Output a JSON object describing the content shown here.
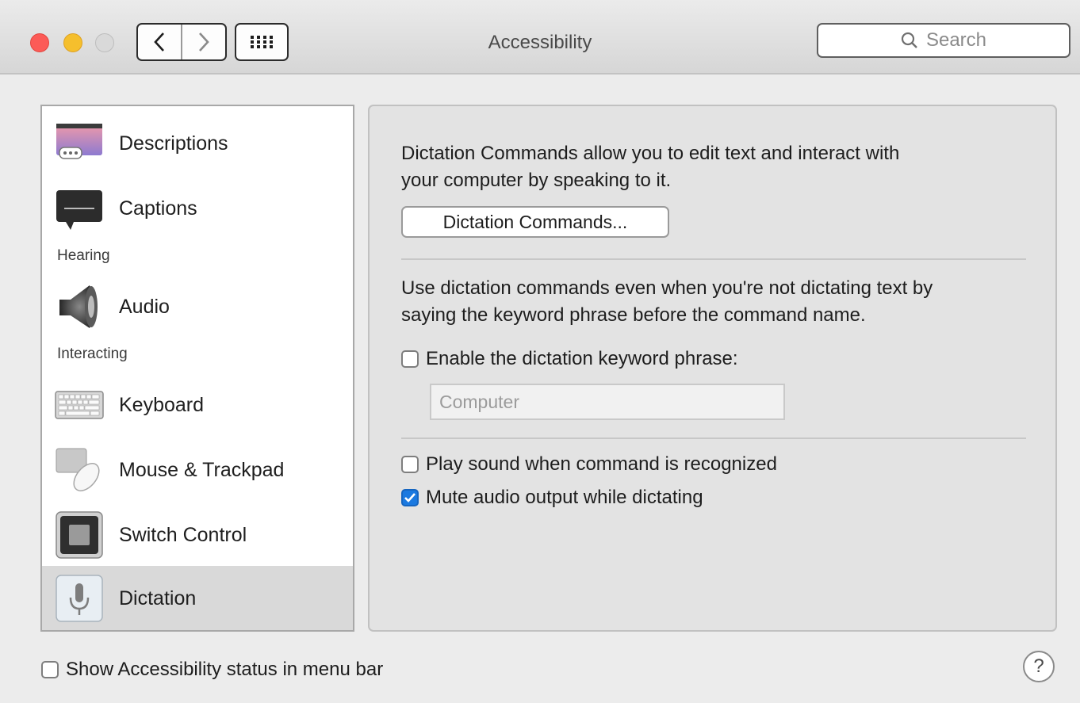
{
  "window": {
    "title": "Accessibility"
  },
  "toolbar": {
    "back_icon": "chevron-left-icon",
    "forward_icon": "chevron-right-icon",
    "grid_icon": "show-all-grid-icon",
    "search_placeholder": "Search"
  },
  "sidebar": {
    "items": [
      {
        "label": "Descriptions",
        "icon": "descriptions-icon"
      },
      {
        "label": "Captions",
        "icon": "captions-icon"
      },
      {
        "section": "Hearing"
      },
      {
        "label": "Audio",
        "icon": "speaker-icon"
      },
      {
        "section": "Interacting"
      },
      {
        "label": "Keyboard",
        "icon": "keyboard-icon"
      },
      {
        "label": "Mouse & Trackpad",
        "icon": "mouse-icon"
      },
      {
        "label": "Switch Control",
        "icon": "switch-control-icon"
      },
      {
        "label": "Dictation",
        "icon": "microphone-icon",
        "selected": true
      }
    ]
  },
  "panel": {
    "intro_line1": "Dictation Commands allow you to edit text and interact with",
    "intro_line2": "your computer by speaking to it.",
    "commands_button": "Dictation Commands...",
    "keyword_desc_line1": "Use dictation commands even when you're not dictating text by",
    "keyword_desc_line2": "saying the keyword phrase before the command name.",
    "enable_keyword": {
      "label": "Enable the dictation keyword phrase:",
      "checked": false
    },
    "keyword_field": {
      "value": "",
      "placeholder": "Computer"
    },
    "play_sound": {
      "label": "Play sound when command is recognized",
      "checked": false
    },
    "mute_audio": {
      "label": "Mute audio output while dictating",
      "checked": true
    }
  },
  "footer": {
    "show_status": {
      "label": "Show Accessibility status in menu bar",
      "checked": false
    },
    "help_label": "?"
  },
  "colors": {
    "close": "#fc5b57",
    "minimize": "#f5bf2d",
    "checkbox_checked": "#1a79e0",
    "selected_row": "#d9d9d9"
  }
}
